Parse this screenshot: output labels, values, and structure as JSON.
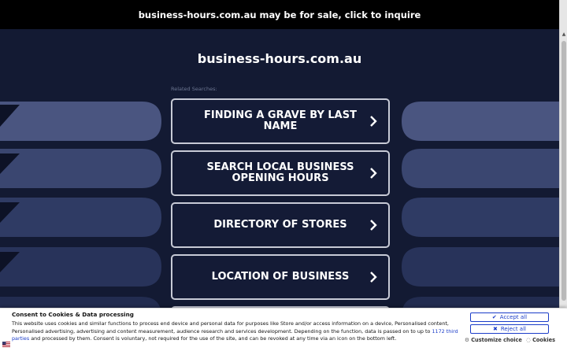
{
  "top_banner": {
    "text": "business-hours.com.au may be for sale, click to inquire"
  },
  "domain_title": "business-hours.com.au",
  "related_label": "Related Searches:",
  "links": [
    {
      "label": "FINDING A GRAVE BY LAST NAME"
    },
    {
      "label": "SEARCH LOCAL BUSINESS OPENING HOURS"
    },
    {
      "label": "DIRECTORY OF STORES"
    },
    {
      "label": "LOCATION OF BUSINESS"
    }
  ],
  "consent": {
    "title": "Consent to Cookies & Data processing",
    "body_part1": "This website uses cookies and similar functions to process end device and personal data for purposes like Store and/or access information on a device, Personalised content, Personalised advertising, advertising and content measurement, audience research and services development. Depending on the function, data is passed on to up to ",
    "third_parties_link": "1172 third parties",
    "body_part2": " and processed by them. Consent is voluntary, not required for the use of the site, and can be revoked at any time via an icon on the bottom left.",
    "accept_label": "Accept all",
    "reject_label": "Reject all",
    "customize_label": "Customize choice",
    "cookies_label": "Cookies"
  },
  "colors": {
    "background": "#131a33",
    "button_border": "#c7cad6",
    "accent_link": "#1a3cc8"
  }
}
